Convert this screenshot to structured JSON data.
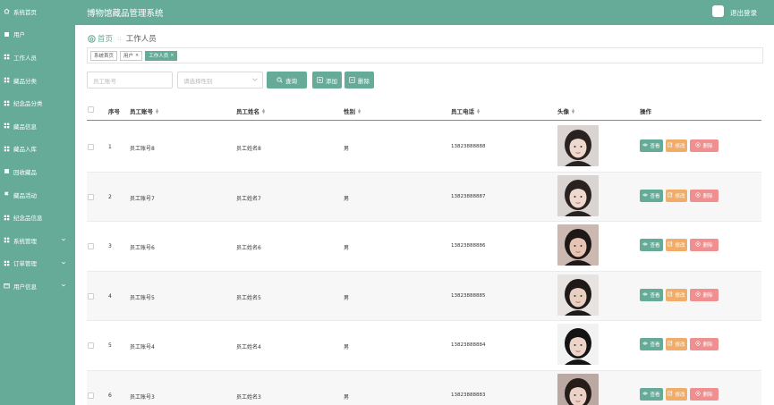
{
  "sidebar": {
    "items": [
      {
        "label": "系统首页",
        "icon": "home-icon"
      },
      {
        "label": "用户",
        "icon": "square-icon"
      },
      {
        "label": "工作人员",
        "icon": "grid-icon"
      },
      {
        "label": "藏品分类",
        "icon": "grid-icon"
      },
      {
        "label": "纪念品分类",
        "icon": "grid-icon"
      },
      {
        "label": "藏品信息",
        "icon": "grid-icon"
      },
      {
        "label": "藏品入库",
        "icon": "grid-icon"
      },
      {
        "label": "回收藏品",
        "icon": "square-icon"
      },
      {
        "label": "藏品活动",
        "icon": "flag-icon"
      },
      {
        "label": "纪念品信息",
        "icon": "grid-icon"
      },
      {
        "label": "系统管理",
        "icon": "grid-icon",
        "expandable": true
      },
      {
        "label": "订单管理",
        "icon": "grid-icon",
        "expandable": true
      },
      {
        "label": "用户信息",
        "icon": "card-icon",
        "expandable": true
      }
    ]
  },
  "header": {
    "title": "博物馆藏品管理系统",
    "logout_label": "退出登录"
  },
  "breadcrumb": {
    "home": "首页",
    "separator": "::",
    "current": "工作人员"
  },
  "tags": [
    {
      "label": "系统首页",
      "closable": false,
      "active": false
    },
    {
      "label": "用户",
      "closable": true,
      "active": false
    },
    {
      "label": "工作人员",
      "closable": true,
      "active": true
    }
  ],
  "search": {
    "id_placeholder": "员工账号",
    "gender_placeholder": "请选择性别",
    "query_label": "查询",
    "add_label": "添加",
    "delete_label": "删除"
  },
  "table": {
    "headers": {
      "index": "序号",
      "account": "员工账号",
      "name": "员工姓名",
      "gender": "性别",
      "phone": "员工电话",
      "avatar": "头像",
      "actions": "操作"
    },
    "action_labels": {
      "view": "查看",
      "edit": "修改",
      "delete": "删除"
    },
    "rows": [
      {
        "index": "1",
        "account": "员工账号8",
        "name": "员工姓名8",
        "gender": "男",
        "phone": "13823888888"
      },
      {
        "index": "2",
        "account": "员工账号7",
        "name": "员工姓名7",
        "gender": "男",
        "phone": "13823888887"
      },
      {
        "index": "3",
        "account": "员工账号6",
        "name": "员工姓名6",
        "gender": "男",
        "phone": "13823888886"
      },
      {
        "index": "4",
        "account": "员工账号5",
        "name": "员工姓名5",
        "gender": "男",
        "phone": "13823888885"
      },
      {
        "index": "5",
        "account": "员工账号4",
        "name": "员工姓名4",
        "gender": "男",
        "phone": "13823888884"
      },
      {
        "index": "6",
        "account": "员工账号3",
        "name": "员工姓名3",
        "gender": "男",
        "phone": "13823888883"
      }
    ]
  },
  "colors": {
    "accent": "#66ab98",
    "edit": "#f0ad6a",
    "delete": "#f08f8f"
  }
}
